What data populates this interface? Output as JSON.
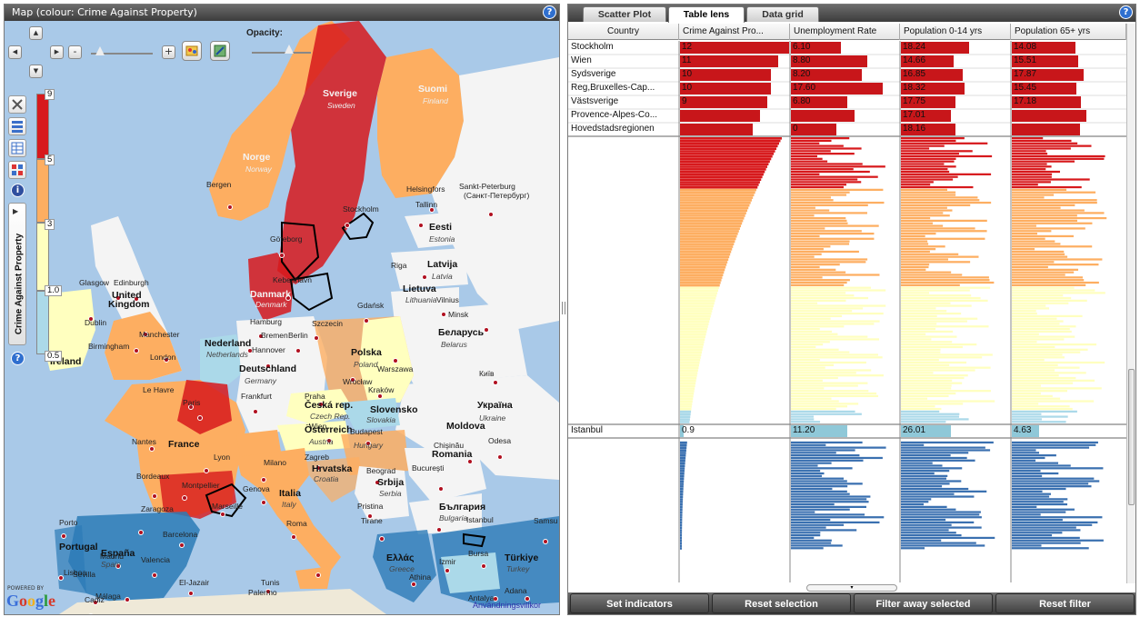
{
  "map": {
    "header_title": "Map (colour: Crime Against Property)",
    "help": "?",
    "opacity_label": "Opacity:",
    "opacity_value": 0.6,
    "zoom_minus": "-",
    "zoom_plus": "+",
    "side_label": "Crime Against Property",
    "legend_ticks": [
      "9",
      "5",
      "3",
      "1.0",
      "0.5"
    ],
    "legend_colors": [
      "#d7191c",
      "#fdae61",
      "#ffffbf",
      "#abd9e9",
      "#2c7bb6"
    ],
    "powered_by": "POWERED BY",
    "google": "Google",
    "terms": "Användningsvillkor",
    "labels": [
      {
        "text": "Sverige",
        "cls": "country white"
      },
      {
        "text": "Sweden",
        "cls": "sub whitesub"
      },
      {
        "text": "Suomi",
        "cls": "country white"
      },
      {
        "text": "Finland",
        "cls": "sub whitesub"
      },
      {
        "text": "Norge",
        "cls": "country white"
      },
      {
        "text": "Norway",
        "cls": "sub whitesub"
      },
      {
        "text": "Bergen",
        "cls": ""
      },
      {
        "text": "Helsingfors",
        "cls": ""
      },
      {
        "text": "Sankt-Peterburg",
        "cls": ""
      },
      {
        "text": "(Санкт-Петербург)",
        "cls": ""
      },
      {
        "text": "Tallinn",
        "cls": ""
      },
      {
        "text": "Stockholm",
        "cls": ""
      },
      {
        "text": "Eesti",
        "cls": "country"
      },
      {
        "text": "Estonia",
        "cls": "sub"
      },
      {
        "text": "Göteborg",
        "cls": ""
      },
      {
        "text": "Latvija",
        "cls": "country"
      },
      {
        "text": "Latvia",
        "cls": "sub"
      },
      {
        "text": "Riga",
        "cls": ""
      },
      {
        "text": "Kebenhavn",
        "cls": ""
      },
      {
        "text": "Danmark",
        "cls": "country white"
      },
      {
        "text": "Denmark",
        "cls": "sub whitesub"
      },
      {
        "text": "Lietuva",
        "cls": "country"
      },
      {
        "text": "Lithuania",
        "cls": "sub"
      },
      {
        "text": "Vilnius",
        "cls": ""
      },
      {
        "text": "Gdańsk",
        "cls": ""
      },
      {
        "text": "Minsk",
        "cls": ""
      },
      {
        "text": "Беларусь",
        "cls": "country"
      },
      {
        "text": "Belarus",
        "cls": "sub"
      },
      {
        "text": "Glasgow",
        "cls": ""
      },
      {
        "text": "Edinburgh",
        "cls": ""
      },
      {
        "text": "United",
        "cls": "country"
      },
      {
        "text": "Kingdom",
        "cls": "country"
      },
      {
        "text": "Dublin",
        "cls": ""
      },
      {
        "text": "Ireland",
        "cls": "country"
      },
      {
        "text": "Manchester",
        "cls": ""
      },
      {
        "text": "Birmingham",
        "cls": ""
      },
      {
        "text": "London",
        "cls": ""
      },
      {
        "text": "Hamburg",
        "cls": ""
      },
      {
        "text": "Szczecin",
        "cls": ""
      },
      {
        "text": "Bremen",
        "cls": ""
      },
      {
        "text": "Berlin",
        "cls": ""
      },
      {
        "text": "Hannover",
        "cls": ""
      },
      {
        "text": "Nederland",
        "cls": "country"
      },
      {
        "text": "Netherlands",
        "cls": "sub"
      },
      {
        "text": "Polska",
        "cls": "country"
      },
      {
        "text": "Poland",
        "cls": "sub"
      },
      {
        "text": "Deutschland",
        "cls": "country"
      },
      {
        "text": "Germany",
        "cls": "sub"
      },
      {
        "text": "Warszawa",
        "cls": ""
      },
      {
        "text": "Wrocław",
        "cls": ""
      },
      {
        "text": "Kraków",
        "cls": ""
      },
      {
        "text": "Київ",
        "cls": ""
      },
      {
        "text": "Україна",
        "cls": "country"
      },
      {
        "text": "Ukraine",
        "cls": "sub"
      },
      {
        "text": "Frankfurt",
        "cls": ""
      },
      {
        "text": "Praha",
        "cls": ""
      },
      {
        "text": "Česká rep.",
        "cls": "country"
      },
      {
        "text": "Czech Rep.",
        "cls": "sub"
      },
      {
        "text": "Slovensko",
        "cls": "country"
      },
      {
        "text": "Slovakia",
        "cls": "sub"
      },
      {
        "text": "Le Havre",
        "cls": ""
      },
      {
        "text": "Paris",
        "cls": ""
      },
      {
        "text": "Nantes",
        "cls": ""
      },
      {
        "text": "France",
        "cls": "country"
      },
      {
        "text": "Wien",
        "cls": ""
      },
      {
        "text": "Österreich",
        "cls": "country"
      },
      {
        "text": "Austria",
        "cls": "sub"
      },
      {
        "text": "Budapest",
        "cls": ""
      },
      {
        "text": "Hungary",
        "cls": "sub"
      },
      {
        "text": "Moldova",
        "cls": "country"
      },
      {
        "text": "Chişinău",
        "cls": ""
      },
      {
        "text": "Odesa",
        "cls": ""
      },
      {
        "text": "Lyon",
        "cls": ""
      },
      {
        "text": "Milano",
        "cls": ""
      },
      {
        "text": "Zagreb",
        "cls": ""
      },
      {
        "text": "Hrvatska",
        "cls": "country"
      },
      {
        "text": "Croatia",
        "cls": "sub"
      },
      {
        "text": "Beograd",
        "cls": ""
      },
      {
        "text": "Srbija",
        "cls": "country"
      },
      {
        "text": "Serbia",
        "cls": "sub"
      },
      {
        "text": "Romania",
        "cls": "country"
      },
      {
        "text": "Bucureşti",
        "cls": ""
      },
      {
        "text": "Bordeaux",
        "cls": ""
      },
      {
        "text": "Montpellier",
        "cls": ""
      },
      {
        "text": "Genova",
        "cls": ""
      },
      {
        "text": "Marseille",
        "cls": ""
      },
      {
        "text": "Italia",
        "cls": "country"
      },
      {
        "text": "Italy",
        "cls": "sub"
      },
      {
        "text": "Pristina",
        "cls": ""
      },
      {
        "text": "България",
        "cls": "country"
      },
      {
        "text": "Bulgaria",
        "cls": "sub"
      },
      {
        "text": "Istanbul",
        "cls": ""
      },
      {
        "text": "Zaragoza",
        "cls": ""
      },
      {
        "text": "Barcelona",
        "cls": ""
      },
      {
        "text": "Roma",
        "cls": ""
      },
      {
        "text": "Tirane",
        "cls": ""
      },
      {
        "text": "Porto",
        "cls": ""
      },
      {
        "text": "Portugal",
        "cls": "country"
      },
      {
        "text": "España",
        "cls": "country"
      },
      {
        "text": "Spain",
        "cls": "sub"
      },
      {
        "text": "Madrid",
        "cls": ""
      },
      {
        "text": "Lisboa",
        "cls": ""
      },
      {
        "text": "Valencia",
        "cls": ""
      },
      {
        "text": "Palermo",
        "cls": ""
      },
      {
        "text": "Ελλάς",
        "cls": "country"
      },
      {
        "text": "Greece",
        "cls": "sub"
      },
      {
        "text": "Izmir",
        "cls": ""
      },
      {
        "text": "Türkiye",
        "cls": "country"
      },
      {
        "text": "Turkey",
        "cls": "sub"
      },
      {
        "text": "Bursa",
        "cls": ""
      },
      {
        "text": "Athina",
        "cls": ""
      },
      {
        "text": "Samsu",
        "cls": ""
      },
      {
        "text": "Sevilla",
        "cls": ""
      },
      {
        "text": "Málaga",
        "cls": ""
      },
      {
        "text": "El-Jazair",
        "cls": ""
      },
      {
        "text": "Tunis",
        "cls": ""
      },
      {
        "text": "Antalya",
        "cls": ""
      },
      {
        "text": "Adana",
        "cls": ""
      },
      {
        "text": "Cadiz",
        "cls": ""
      }
    ]
  },
  "right": {
    "help": "?",
    "tabs": [
      {
        "label": "Scatter Plot",
        "active": false
      },
      {
        "label": "Table lens",
        "active": true
      },
      {
        "label": "Data grid",
        "active": false
      }
    ],
    "columns": [
      "Country",
      "Crime Against Pro...",
      "Unemployment Rate",
      "Population 0-14 yrs",
      "Population 65+ yrs"
    ],
    "selected_rows": [
      {
        "country": "Stockholm",
        "values": [
          "12",
          "6.10",
          "18.24",
          "14.08"
        ]
      },
      {
        "country": "Wien",
        "values": [
          "11",
          "8.80",
          "14.66",
          "15.51"
        ]
      },
      {
        "country": "Sydsverige",
        "values": [
          "10",
          "8.20",
          "16.85",
          "17.87"
        ]
      },
      {
        "country": "Reg,Bruxelles-Cap...",
        "values": [
          "10",
          "17.60",
          "18.32",
          "15.45"
        ]
      },
      {
        "country": "Västsverige",
        "values": [
          "9",
          "6.80",
          "17.75",
          "17.18"
        ]
      },
      {
        "country": "Provence-Alpes-Co...",
        "values": [
          "",
          "",
          "17.01",
          ""
        ]
      },
      {
        "country": "Hovedstadsregionen",
        "values": [
          "",
          "0",
          "18.16",
          ""
        ]
      }
    ],
    "focus_row": {
      "country": "Istanbul",
      "values": [
        "0.9",
        "11.20",
        "26.01",
        "4.63"
      ]
    },
    "buttons": [
      "Set indicators",
      "Reset selection",
      "Filter away selected",
      "Reset filter"
    ]
  }
}
